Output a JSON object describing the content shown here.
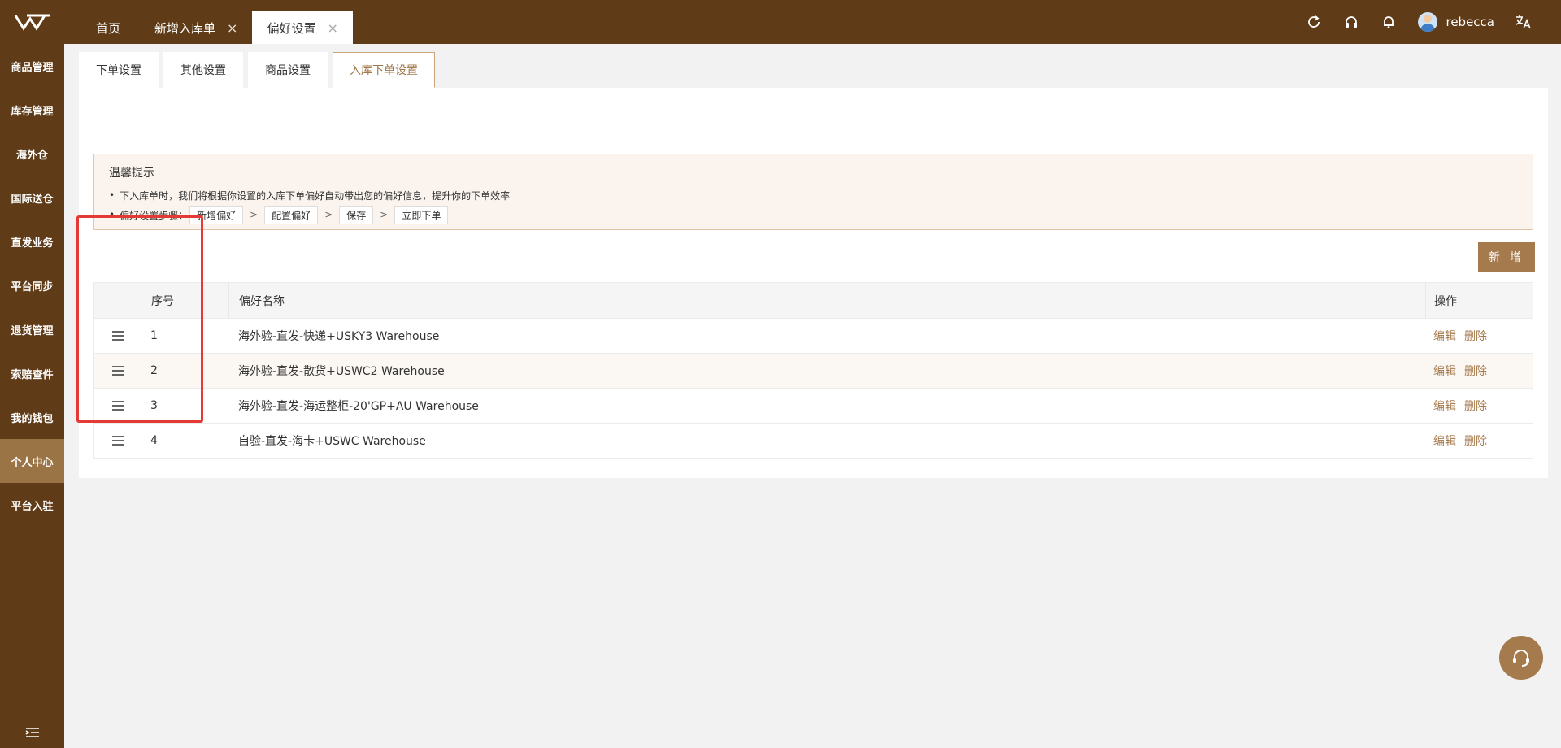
{
  "topbar": {
    "tabs": [
      {
        "label": "首页"
      },
      {
        "label": "新增入库单",
        "close": "×"
      },
      {
        "label": "偏好设置",
        "close": "×"
      }
    ],
    "user": "rebecca"
  },
  "sidebar": {
    "items": [
      "商品管理",
      "库存管理",
      "海外仓",
      "国际送仓",
      "直发业务",
      "平台同步",
      "退货管理",
      "索赔查件",
      "我的钱包",
      "个人中心",
      "平台入驻"
    ]
  },
  "subtabs": [
    "下单设置",
    "其他设置",
    "商品设置",
    "入库下单设置"
  ],
  "notice": {
    "title": "温馨提示",
    "line1": "下入库单时，我们将根据你设置的入库下单偏好自动带出您的偏好信息，提升你的下单效率",
    "line2_prefix": "偏好设置步骤：",
    "steps": [
      "新增偏好",
      "配置偏好",
      "保存",
      "立即下单"
    ],
    "separator": ">"
  },
  "add_button": "新 增",
  "table": {
    "headers": {
      "index": "序号",
      "name": "偏好名称",
      "ops": "操作"
    },
    "rows": [
      {
        "index": "1",
        "name": "海外验-直发-快递+USKY3 Warehouse"
      },
      {
        "index": "2",
        "name": "海外验-直发-散货+USWC2 Warehouse"
      },
      {
        "index": "3",
        "name": "海外验-直发-海运整柜-20'GP+AU Warehouse"
      },
      {
        "index": "4",
        "name": "自验-直发-海卡+USWC Warehouse"
      }
    ],
    "edit_label": "编辑",
    "delete_label": "删除"
  },
  "colors": {
    "brand": "#5f3b17",
    "accent": "#a57a4d",
    "highlight": "#e53935"
  }
}
